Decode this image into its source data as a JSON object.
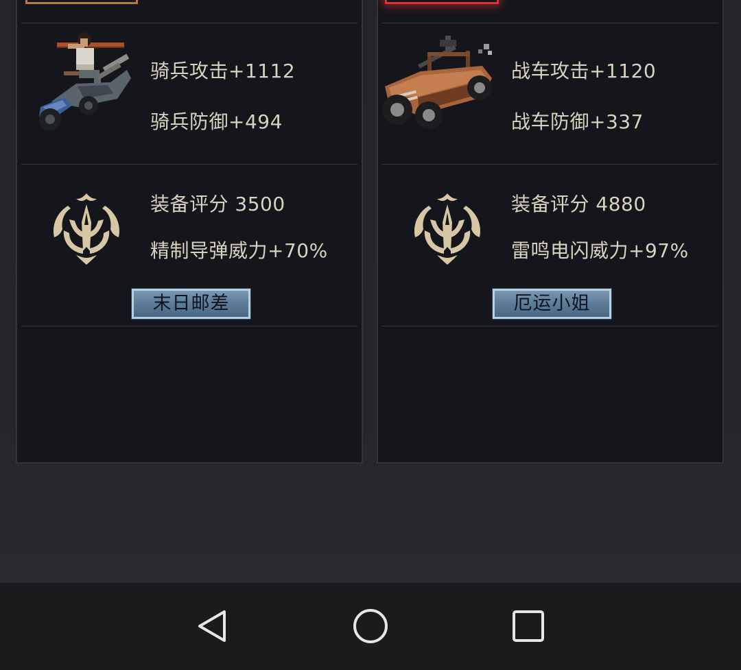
{
  "cards": [
    {
      "unit_stats": [
        "骑兵攻击+1112",
        "骑兵防御+494"
      ],
      "score_line": "装备评分 3500",
      "skill_line": "精制导弹威力+70%",
      "hero_button": "末日邮差",
      "unit_icon": "motorcycle-rider-icon",
      "emblem_icon": "trident-emblem-icon",
      "frame_color": "#b77a3e"
    },
    {
      "unit_stats": [
        "战车攻击+1120",
        "战车防御+337"
      ],
      "score_line": "装备评分 4880",
      "skill_line": "雷鸣电闪威力+97%",
      "hero_button": "厄运小姐",
      "unit_icon": "armored-buggy-icon",
      "emblem_icon": "trident-emblem-icon",
      "frame_color": "#e03030"
    }
  ],
  "navbar": {
    "back_icon": "back-triangle-icon",
    "home_icon": "home-circle-icon",
    "recents_icon": "recents-square-icon"
  }
}
